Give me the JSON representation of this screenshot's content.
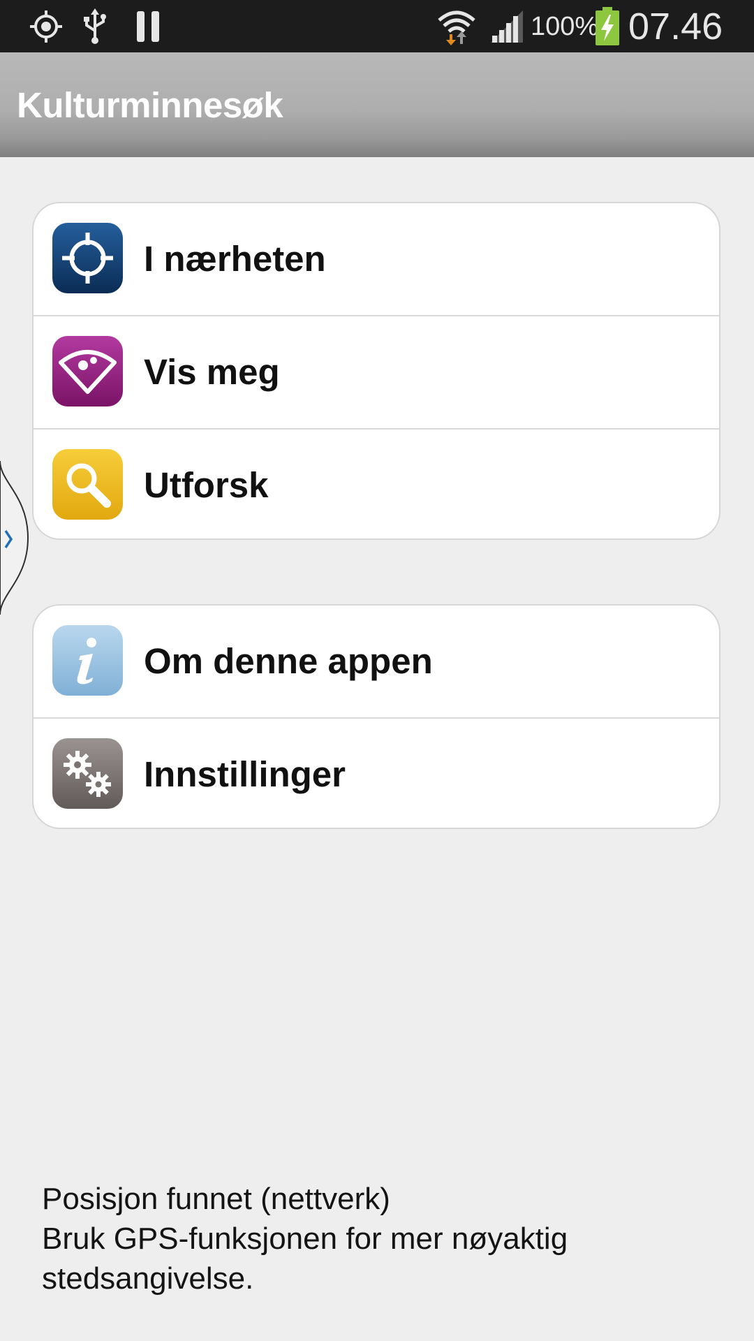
{
  "status_bar": {
    "icons": [
      "location-icon",
      "usb-icon",
      "pause-icon",
      "wifi-icon",
      "signal-icon",
      "battery-charging-icon"
    ],
    "battery_percent": "100%",
    "time": "07.46"
  },
  "action_bar": {
    "title": "Kulturminnesøk"
  },
  "menu_primary": [
    {
      "label": "I nærheten",
      "icon": "crosshair-icon",
      "color": "#0f3766"
    },
    {
      "label": "Vis meg",
      "icon": "radar-eye-icon",
      "color": "#8e1a7c"
    },
    {
      "label": "Utforsk",
      "icon": "magnifier-icon",
      "color": "#e6b219"
    }
  ],
  "menu_secondary": [
    {
      "label": "Om denne appen",
      "icon": "info-icon",
      "color": "#92bde0"
    },
    {
      "label": "Innstillinger",
      "icon": "gears-icon",
      "color": "#77706f"
    }
  ],
  "footer": {
    "line1": "Posisjon funnet (nettverk)",
    "line2": "Bruk GPS-funksjonen for mer nøyaktig",
    "line3": "stedsangivelse."
  },
  "colors": {
    "status_bar_bg": "#1c1c1c",
    "action_bar_bg": "#b0b0b0",
    "page_bg": "#eeeeee",
    "card_bg": "#ffffff",
    "wifi_arrow": "#e08a1e",
    "battery_fill": "#8dc63f"
  }
}
